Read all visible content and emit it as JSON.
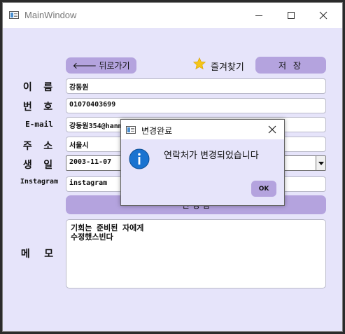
{
  "window": {
    "title": "MainWindow"
  },
  "toolbar": {
    "back_label": "뒤로가기",
    "back_arrow": "🡐",
    "favorite_label": "즐겨찾기",
    "save_label": "저 장"
  },
  "form": {
    "name": {
      "label": "이 름",
      "value": "강동원"
    },
    "number": {
      "label": "번 호",
      "value": "01070403699"
    },
    "email": {
      "label": "E-mail",
      "value": "강동원354@hanmail.net"
    },
    "address": {
      "label": "주 소",
      "value": "서울시"
    },
    "birthday": {
      "label": "생 일",
      "value": "2003-11-07"
    },
    "instagram": {
      "label": "Instagram",
      "value": "instagram"
    },
    "change_button_label": "변 경 함",
    "memo": {
      "label": "메 모",
      "lines": [
        "기회는 준비된 자에게",
        "수정했스빈다"
      ]
    }
  },
  "dialog": {
    "title": "변경완료",
    "message": "연락처가 변경되었습니다",
    "ok_label": "OK"
  },
  "colors": {
    "accent": "#b4a3de",
    "background": "#e6e4fa",
    "info": "#1a73d0"
  }
}
